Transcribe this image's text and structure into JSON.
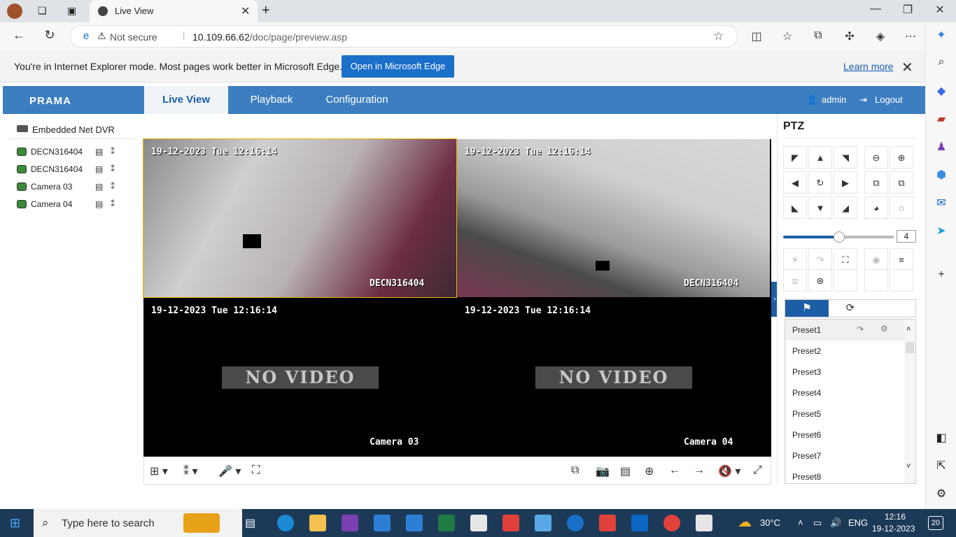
{
  "browser": {
    "tab_title": "Live View",
    "security": "Not secure",
    "url_host": "10.109.66.62",
    "url_path": "/doc/page/preview.asp"
  },
  "ie_banner": {
    "message": "You're in Internet Explorer mode. Most pages work better in Microsoft Edge.",
    "button": "Open in Microsoft Edge",
    "link": "Learn more"
  },
  "app": {
    "logo": "PRAMA",
    "tabs": [
      "Live View",
      "Playback",
      "Configuration"
    ],
    "user": "admin",
    "logout": "Logout"
  },
  "tree": {
    "root": "Embedded Net DVR",
    "items": [
      "DECN316404",
      "DECN316404",
      "Camera 03",
      "Camera 04"
    ]
  },
  "video": {
    "cells": [
      {
        "timestamp": "19-12-2023 Tue 12:16:14",
        "label": "DECN316404",
        "no_video": ""
      },
      {
        "timestamp": "19-12-2023 Tue 12:16:14",
        "label": "DECN316404",
        "no_video": ""
      },
      {
        "timestamp": "19-12-2023 Tue 12:16:14",
        "label": "Camera 03",
        "no_video": "NO VIDEO"
      },
      {
        "timestamp": "19-12-2023 Tue 12:16:14",
        "label": "Camera 04",
        "no_video": "NO VIDEO"
      }
    ]
  },
  "ptz": {
    "title": "PTZ",
    "speed": "4",
    "presets": [
      "Preset1",
      "Preset2",
      "Preset3",
      "Preset4",
      "Preset5",
      "Preset6",
      "Preset7",
      "Preset8"
    ]
  },
  "taskbar": {
    "search_placeholder": "Type here to search",
    "weather": "30°C",
    "lang": "ENG",
    "time": "12:16",
    "date": "19-12-2023",
    "notifications": "20"
  }
}
